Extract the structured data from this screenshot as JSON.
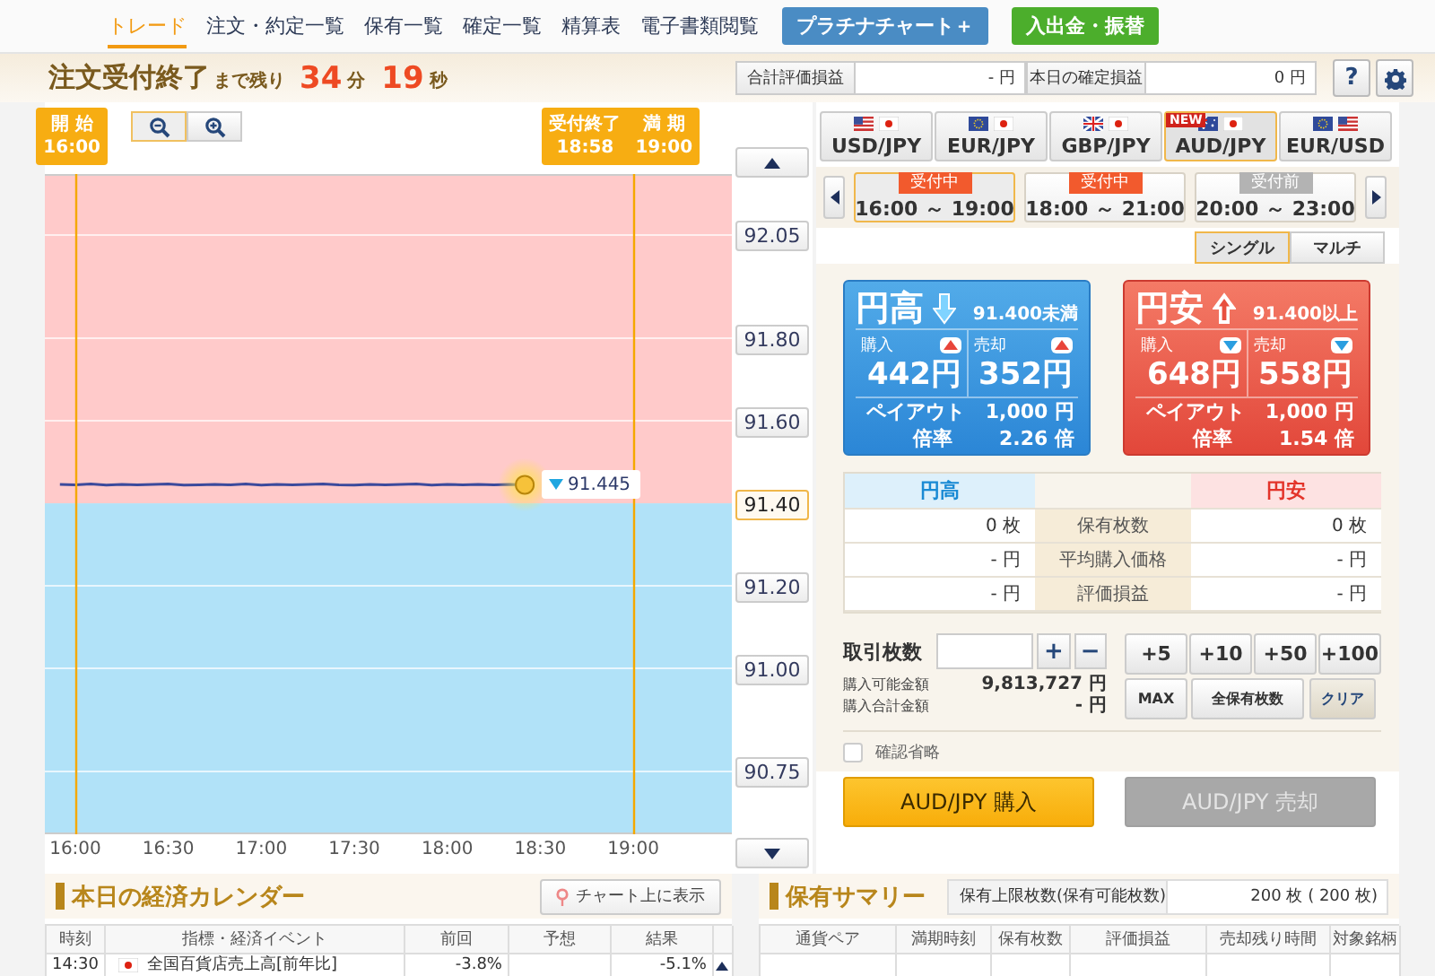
{
  "nav": {
    "items": [
      {
        "label": "トレード",
        "kind": "link",
        "selected": true
      },
      {
        "label": "注文・約定一覧",
        "kind": "link",
        "selected": false
      },
      {
        "label": "保有一覧",
        "kind": "link",
        "selected": false
      },
      {
        "label": "確定一覧",
        "kind": "link",
        "selected": false
      },
      {
        "label": "精算表",
        "kind": "link",
        "selected": false
      },
      {
        "label": "電子書類閲覧",
        "kind": "link",
        "selected": false
      },
      {
        "label": "プラチナチャート＋",
        "kind": "button",
        "color": "#4a8cc4",
        "selected": false
      },
      {
        "label": "入出金・振替",
        "kind": "button",
        "color": "#4cae2c",
        "selected": false
      }
    ]
  },
  "header": {
    "status": "注文受付終了",
    "remaining_label": "まで残り",
    "minutes": "34",
    "minutes_unit": "分",
    "seconds": "19",
    "seconds_unit": "秒",
    "summary": [
      {
        "label": "合計評価損益",
        "value": "- 円"
      },
      {
        "label": "本日の確定損益",
        "value": "0 円"
      }
    ],
    "help": "?"
  },
  "chart": {
    "chart_data": {
      "type": "line",
      "categories": [
        null,
        "16:00",
        null,
        null,
        null,
        null,
        null,
        "16:30",
        null,
        null,
        null,
        null,
        null,
        "17:00",
        null,
        null,
        null,
        null,
        null,
        "17:30",
        null,
        null,
        null,
        null,
        null,
        "18:00",
        null,
        null,
        null,
        null,
        null,
        "18:30",
        null,
        null,
        null,
        null,
        null,
        "19:00",
        null,
        null,
        null,
        null,
        null,
        null
      ],
      "series": [
        {
          "color": "#3b4a9c",
          "values": [
            91.446,
            91.445,
            91.447,
            91.444,
            91.446,
            91.445,
            91.446,
            91.447,
            91.444,
            91.445,
            91.446,
            91.445,
            91.447,
            91.444,
            91.446,
            91.445,
            91.446,
            91.447,
            91.445,
            91.444,
            91.446,
            91.445,
            91.446,
            91.447,
            91.444,
            91.446,
            91.445,
            91.446,
            91.445,
            91.446,
            91.445,
            null,
            null,
            null,
            null,
            null,
            null,
            null,
            null,
            null,
            null,
            null,
            null,
            null
          ]
        }
      ],
      "ylim": [
        90.598,
        92.198
      ],
      "grid": true,
      "yticks": [
        {
          "value": 92.05,
          "label": "92.05"
        },
        {
          "value": 91.8,
          "label": "91.80"
        },
        {
          "value": 91.6,
          "label": "91.60"
        },
        {
          "value": 91.2,
          "label": "91.20"
        },
        {
          "value": 91.0,
          "label": "91.00"
        },
        {
          "value": 90.75,
          "label": "90.75"
        }
      ]
    },
    "threshold": {
      "label": "91.40"
    },
    "current_price": {
      "label": "91.445",
      "kind": "down"
    },
    "markers": [
      {
        "labels": [
          {
            "title": "開 始",
            "time": "16:00"
          }
        ]
      },
      {
        "labels": [
          {
            "title": "受付終了",
            "time": "18:58"
          },
          {
            "title": "満 期",
            "time": "19:00"
          }
        ]
      }
    ]
  },
  "pairs": [
    {
      "label": "USD/JPY",
      "flags": [
        {
          "kind": "us"
        },
        {
          "kind": "jp"
        }
      ],
      "selected": false
    },
    {
      "label": "EUR/JPY",
      "flags": [
        {
          "kind": "eu"
        },
        {
          "kind": "jp"
        }
      ],
      "selected": false
    },
    {
      "label": "GBP/JPY",
      "flags": [
        {
          "kind": "gb"
        },
        {
          "kind": "jp"
        }
      ],
      "selected": false
    },
    {
      "label": "AUD/JPY",
      "flags": [
        {
          "kind": "au"
        },
        {
          "kind": "jp"
        }
      ],
      "badge": "NEW",
      "selected": true
    },
    {
      "label": "EUR/USD",
      "flags": [
        {
          "kind": "eu"
        },
        {
          "kind": "us"
        }
      ],
      "selected": false
    }
  ],
  "sessions": [
    {
      "status": "受付中",
      "kind": "open",
      "time": "16:00 ～ 19:00",
      "selected": true
    },
    {
      "status": "受付中",
      "kind": "open",
      "time": "18:00 ～ 21:00",
      "selected": false
    },
    {
      "status": "受付前",
      "kind": "pending",
      "time": "20:00 ～ 23:00",
      "selected": false
    }
  ],
  "modes": [
    {
      "label": "シングル",
      "selected": true
    },
    {
      "label": "マルチ",
      "selected": false
    }
  ],
  "options": [
    {
      "kind": "high",
      "title": "円高",
      "arrow": {
        "kind": "down"
      },
      "condition": "91.400未満",
      "prices": [
        {
          "label": "購入",
          "kind": "up",
          "value": "442円"
        },
        {
          "label": "売却",
          "kind": "up",
          "value": "352円"
        }
      ],
      "payout": {
        "label": "ペイアウト",
        "value": "1,000 円"
      },
      "rate": {
        "label": "倍率",
        "value": "2.26 倍"
      }
    },
    {
      "kind": "low",
      "title": "円安",
      "arrow": {
        "kind": "up"
      },
      "condition": "91.400以上",
      "prices": [
        {
          "label": "購入",
          "kind": "down",
          "value": "648円"
        },
        {
          "label": "売却",
          "kind": "down",
          "value": "558円"
        }
      ],
      "payout": {
        "label": "ペイアウト",
        "value": "1,000 円"
      },
      "rate": {
        "label": "倍率",
        "value": "1.54 倍"
      }
    }
  ],
  "holdings": {
    "columns": [
      "円高",
      "円安"
    ],
    "rows": [
      {
        "label": "保有枚数",
        "high": "0 枚",
        "low": "0 枚"
      },
      {
        "label": "平均購入価格",
        "high": "- 円",
        "low": "- 円"
      },
      {
        "label": "評価損益",
        "high": "- 円",
        "low": "- 円"
      }
    ]
  },
  "order": {
    "label": "取引枚数",
    "steppers": [
      "+",
      "−"
    ],
    "quick": [
      "+5",
      "+10",
      "+50",
      "+100"
    ],
    "actions": [
      {
        "label": "MAX",
        "kind": "plain"
      },
      {
        "label": "全保有枚数",
        "kind": "plain"
      },
      {
        "label": "クリア",
        "kind": "clear"
      }
    ],
    "amounts": [
      {
        "label": "購入可能金額",
        "value": "9,813,727 円"
      },
      {
        "label": "購入合計金額",
        "value": "- 円"
      }
    ],
    "skip_confirm": {
      "label": "確認省略",
      "checked": false
    },
    "trade_buttons": [
      {
        "label": "AUD/JPY 購入",
        "disabled": false
      },
      {
        "label": "AUD/JPY 売却",
        "disabled": true
      }
    ]
  },
  "calendar": {
    "title": "本日の経済カレンダー",
    "button": "チャート上に表示",
    "columns": [
      "時刻",
      "指標・経済イベント",
      "前回",
      "予想",
      "結果"
    ],
    "rows": [
      {
        "time": "14:30",
        "flag": {
          "kind": "jp"
        },
        "event": "全国百貨店売上高[前年比]",
        "previous": "-3.8%",
        "result": "-5.1%"
      }
    ]
  },
  "summary": {
    "title": "保有サマリー",
    "limit_label": "保有上限枚数(保有可能枚数)",
    "limit_value": "200 枚 ( 200 枚)",
    "columns": [
      "通貨ペア",
      "満期時刻",
      "保有枚数",
      "評価損益",
      "売却残り時間",
      "対象銘柄"
    ]
  }
}
